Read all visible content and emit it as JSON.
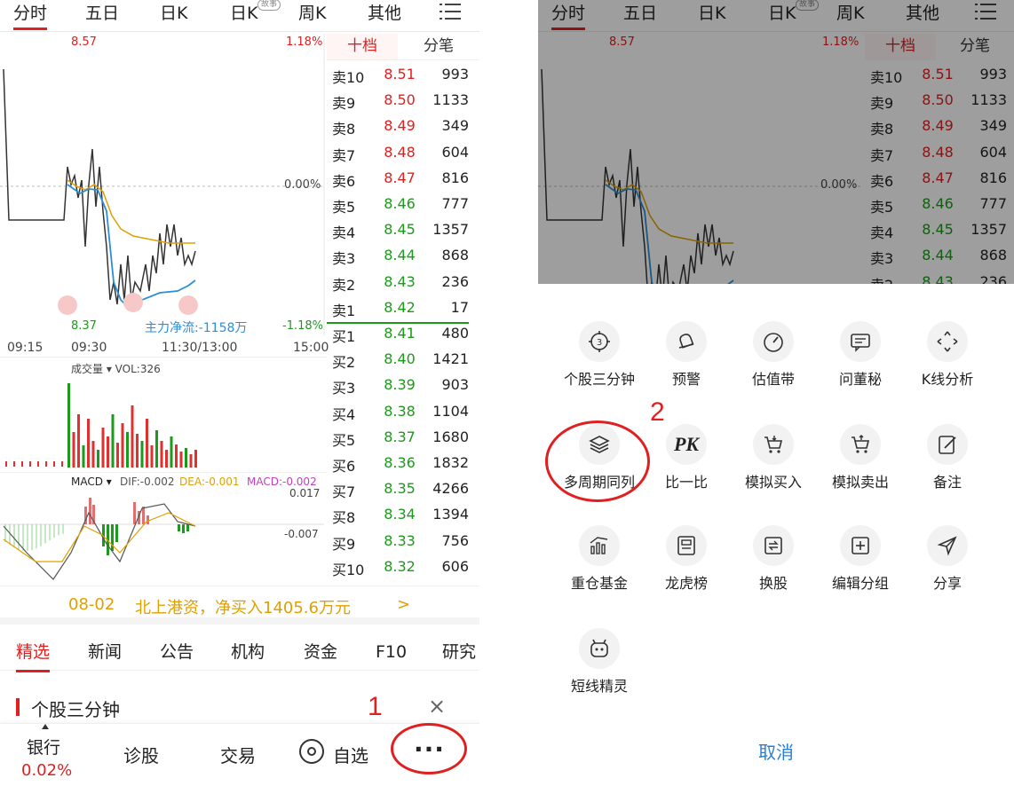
{
  "tabs": [
    "分时",
    "五日",
    "日K",
    "日K",
    "周K",
    "其他"
  ],
  "tab_badge": "故事",
  "chart": {
    "price_high": "8.57",
    "pct_high": "1.18%",
    "pct_zero": "0.00%",
    "price_low": "8.37",
    "pct_low": "-1.18%",
    "flow_label": "主力净流:-1158万",
    "times": [
      "09:15",
      "09:30",
      "11:30/13:00",
      "15:00"
    ],
    "vol_label": "成交量 ▾ VOL:326",
    "macd_name": "MACD ▾",
    "macd_dif": "DIF:-0.002",
    "macd_dea": "DEA:-0.001",
    "macd_val": "MACD:-0.002",
    "macd_top": "0.017",
    "macd_bot": "-0.007",
    "colors": {
      "price": "#333333",
      "avg": "#e0a000",
      "flow": "#2a8fd8",
      "up": "#e03030",
      "down": "#1b9a1b"
    }
  },
  "book": {
    "tab_depth": "十档",
    "tab_ticks": "分笔",
    "asks": [
      {
        "label": "卖10",
        "price": "8.51",
        "vol": "993"
      },
      {
        "label": "卖9",
        "price": "8.50",
        "vol": "1133"
      },
      {
        "label": "卖8",
        "price": "8.49",
        "vol": "349"
      },
      {
        "label": "卖7",
        "price": "8.48",
        "vol": "604"
      },
      {
        "label": "卖6",
        "price": "8.47",
        "vol": "816"
      },
      {
        "label": "卖5",
        "price": "8.46",
        "vol": "777"
      },
      {
        "label": "卖4",
        "price": "8.45",
        "vol": "1357"
      },
      {
        "label": "卖3",
        "price": "8.44",
        "vol": "868"
      },
      {
        "label": "卖2",
        "price": "8.43",
        "vol": "236"
      },
      {
        "label": "卖1",
        "price": "8.42",
        "vol": "17"
      }
    ],
    "bids": [
      {
        "label": "买1",
        "price": "8.41",
        "vol": "480"
      },
      {
        "label": "买2",
        "price": "8.40",
        "vol": "1421"
      },
      {
        "label": "买3",
        "price": "8.39",
        "vol": "903"
      },
      {
        "label": "买4",
        "price": "8.38",
        "vol": "1104"
      },
      {
        "label": "买5",
        "price": "8.37",
        "vol": "1680"
      },
      {
        "label": "买6",
        "price": "8.36",
        "vol": "1832"
      },
      {
        "label": "买7",
        "price": "8.35",
        "vol": "4266"
      },
      {
        "label": "买8",
        "price": "8.34",
        "vol": "1394"
      },
      {
        "label": "买9",
        "price": "8.33",
        "vol": "756"
      },
      {
        "label": "买10",
        "price": "8.32",
        "vol": "606"
      }
    ]
  },
  "news_bar": {
    "date": "08-02",
    "text": "北上港资，净买入1405.6万元",
    "arrow": ">"
  },
  "content_tabs": [
    "精选",
    "新闻",
    "公告",
    "机构",
    "资金",
    "F10",
    "研究"
  ],
  "card_title": "个股三分钟",
  "card_close": "×",
  "bottom": {
    "sector": "银行",
    "sector_pct": "0.02%",
    "diagnose": "诊股",
    "trade": "交易",
    "watch": "自选",
    "more": "···"
  },
  "annotations": {
    "step1": "1",
    "step2": "2"
  },
  "menu": [
    {
      "label": "个股三分钟",
      "icon": "three-minute-icon"
    },
    {
      "label": "预警",
      "icon": "bell-icon"
    },
    {
      "label": "估值带",
      "icon": "gauge-icon"
    },
    {
      "label": "问董秘",
      "icon": "message-icon"
    },
    {
      "label": "K线分析",
      "icon": "move-icon"
    },
    {
      "label": "多周期同列",
      "icon": "layers-icon"
    },
    {
      "label": "比一比",
      "icon": "pk-icon"
    },
    {
      "label": "模拟买入",
      "icon": "cart-buy-icon"
    },
    {
      "label": "模拟卖出",
      "icon": "cart-sell-icon"
    },
    {
      "label": "备注",
      "icon": "edit-icon"
    },
    {
      "label": "重仓基金",
      "icon": "bar-chart-icon"
    },
    {
      "label": "龙虎榜",
      "icon": "board-icon"
    },
    {
      "label": "换股",
      "icon": "swap-icon"
    },
    {
      "label": "编辑分组",
      "icon": "add-box-icon"
    },
    {
      "label": "分享",
      "icon": "share-icon"
    },
    {
      "label": "短线精灵",
      "icon": "robot-icon"
    }
  ],
  "pk_text": "PK",
  "cancel": "取消"
}
